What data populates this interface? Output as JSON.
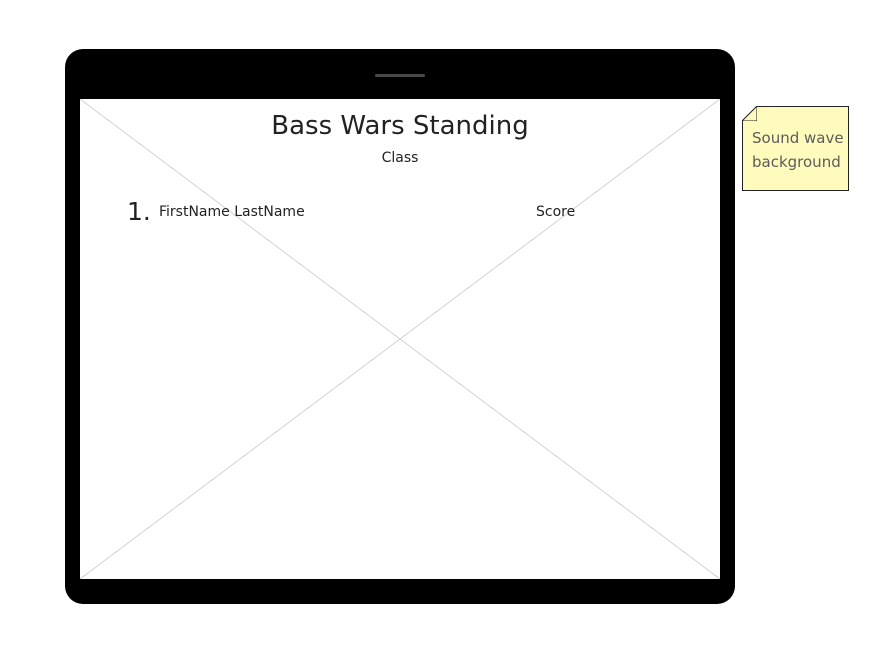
{
  "screen": {
    "title": "Bass Wars Standing",
    "subtitle": "Class",
    "leaderboard": [
      {
        "rank": "1.",
        "name": "FirstName LastName",
        "score": "Score"
      }
    ]
  },
  "annotation": {
    "text": "Sound wave background"
  },
  "colors": {
    "device_frame": "#000000",
    "screen_background": "#ffffff",
    "placeholder_lines": "#d2d2d2",
    "note_background": "#fffbbc",
    "note_text": "#5c5c5c"
  },
  "icons": {
    "screen_placeholder": "image-placeholder-icon",
    "note_fold": "note-fold-icon"
  }
}
